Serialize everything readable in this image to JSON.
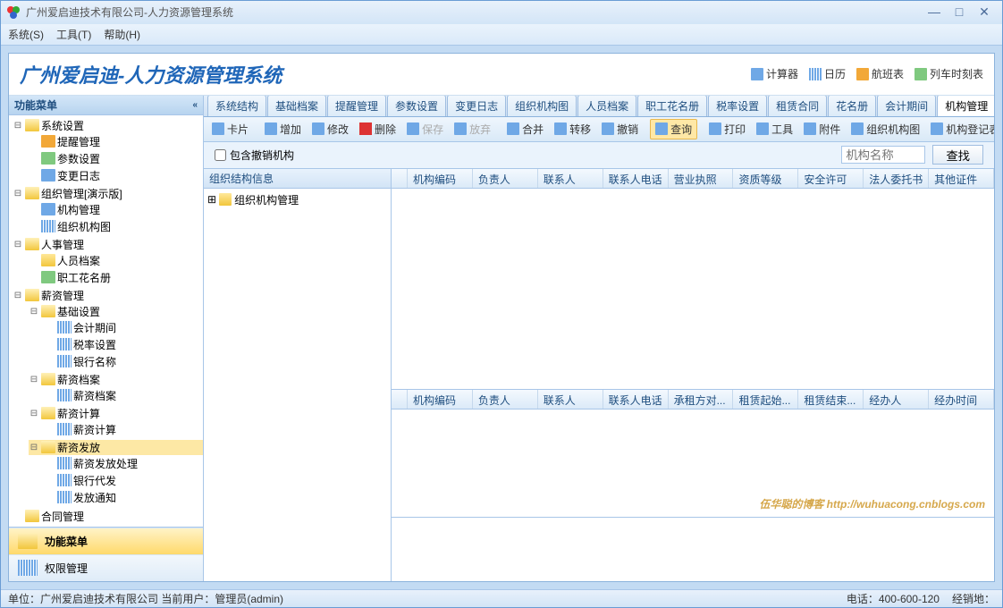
{
  "window_title": "广州爱启迪技术有限公司-人力资源管理系统",
  "menubar": [
    "系统(S)",
    "工具(T)",
    "帮助(H)"
  ],
  "banner": {
    "title": "广州爱启迪-人力资源管理系统",
    "tools": [
      "计算器",
      "日历",
      "航班表",
      "列车时刻表"
    ]
  },
  "sidebar": {
    "header": "功能菜单",
    "nav": [
      {
        "label": "功能菜单",
        "active": true
      },
      {
        "label": "权限管理",
        "active": false
      }
    ],
    "tree": [
      {
        "label": "系统设置",
        "icon": "folder-open",
        "expanded": true,
        "children": [
          {
            "label": "提醒管理",
            "icon": "doc-orange"
          },
          {
            "label": "参数设置",
            "icon": "doc-green"
          },
          {
            "label": "变更日志",
            "icon": "doc-blue"
          }
        ]
      },
      {
        "label": "组织管理[演示版]",
        "icon": "folder-open",
        "expanded": true,
        "children": [
          {
            "label": "机构管理",
            "icon": "doc-blue"
          },
          {
            "label": "组织机构图",
            "icon": "grid-ico"
          }
        ]
      },
      {
        "label": "人事管理",
        "icon": "folder-open",
        "expanded": true,
        "children": [
          {
            "label": "人员档案",
            "icon": "folder"
          },
          {
            "label": "职工花名册",
            "icon": "doc-green"
          }
        ]
      },
      {
        "label": "薪资管理",
        "icon": "folder-open",
        "expanded": true,
        "children": [
          {
            "label": "基础设置",
            "icon": "folder-open",
            "expanded": true,
            "children": [
              {
                "label": "会计期间",
                "icon": "grid-ico"
              },
              {
                "label": "税率设置",
                "icon": "grid-ico"
              },
              {
                "label": "银行名称",
                "icon": "grid-ico"
              }
            ]
          },
          {
            "label": "薪资档案",
            "icon": "folder-open",
            "expanded": true,
            "children": [
              {
                "label": "薪资档案",
                "icon": "grid-ico"
              }
            ]
          },
          {
            "label": "薪资计算",
            "icon": "folder-open",
            "expanded": true,
            "children": [
              {
                "label": "薪资计算",
                "icon": "grid-ico"
              }
            ]
          },
          {
            "label": "薪资发放",
            "icon": "folder-open",
            "expanded": true,
            "selected": true,
            "children": [
              {
                "label": "薪资发放处理",
                "icon": "grid-ico"
              },
              {
                "label": "银行代发",
                "icon": "grid-ico"
              },
              {
                "label": "发放通知",
                "icon": "grid-ico"
              }
            ]
          }
        ]
      },
      {
        "label": "合同管理",
        "icon": "folder-open",
        "expanded": true,
        "truncated": true
      }
    ]
  },
  "tabs": [
    "系统结构",
    "基础档案",
    "提醒管理",
    "参数设置",
    "变更日志",
    "组织机构图",
    "人员档案",
    "职工花名册",
    "税率设置",
    "租赁合同",
    "花名册",
    "会计期间",
    "机构管理"
  ],
  "active_tab": "机构管理",
  "toolbar": [
    {
      "label": "卡片"
    },
    {
      "label": "增加"
    },
    {
      "label": "修改"
    },
    {
      "label": "删除",
      "red": true
    },
    {
      "label": "保存",
      "disabled": true
    },
    {
      "label": "放弃",
      "disabled": true
    },
    {
      "label": "合并"
    },
    {
      "label": "转移"
    },
    {
      "label": "撤销"
    },
    {
      "label": "查询",
      "highlight": true
    },
    {
      "label": "打印"
    },
    {
      "label": "工具"
    },
    {
      "label": "附件"
    },
    {
      "label": "组织机构图"
    },
    {
      "label": "机构登记表"
    }
  ],
  "filter": {
    "checkbox_label": "包含撤销机构",
    "input_placeholder": "机构名称",
    "search_button": "查找"
  },
  "left_pane": {
    "header": "组织结构信息",
    "root": "组织机构管理"
  },
  "grid_top_headers": [
    "",
    "机构编码",
    "负责人",
    "联系人",
    "联系人电话",
    "营业执照",
    "资质等级",
    "安全许可",
    "法人委托书",
    "其他证件"
  ],
  "grid_bottom_headers": [
    "",
    "机构编码",
    "负责人",
    "联系人",
    "联系人电话",
    "承租方对...",
    "租赁起始...",
    "租赁结束...",
    "经办人",
    "经办时间"
  ],
  "watermark": {
    "text": "伍华聪的博客",
    "url": "http://wuhuacong.cnblogs.com"
  },
  "status": {
    "left": "单位：广州爱启迪技术有限公司 当前用户：管理员(admin)",
    "phone_label": "电话：",
    "phone": "400-600-120",
    "dist_label": "经销地："
  }
}
